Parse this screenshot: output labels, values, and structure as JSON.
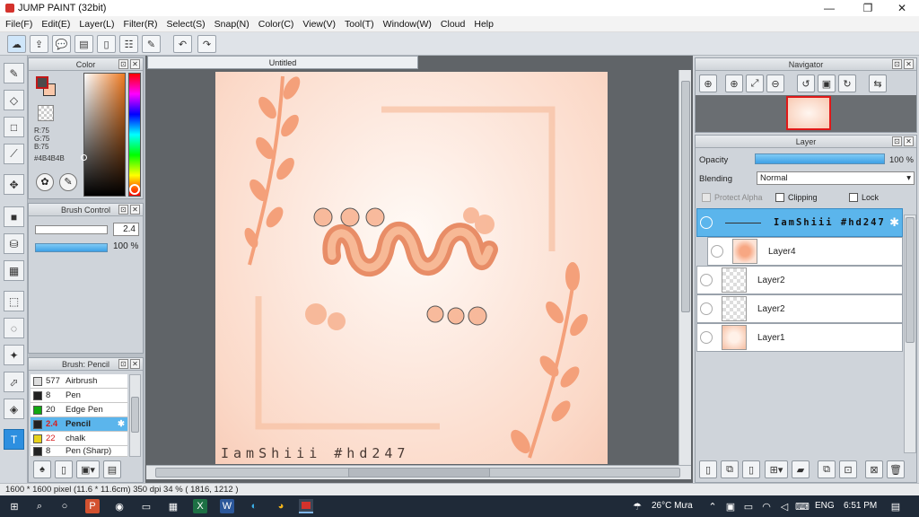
{
  "window": {
    "title": "JUMP PAINT (32bit)",
    "minimize": "—",
    "maximize": "❐",
    "close": "✕"
  },
  "menu": [
    "File(F)",
    "Edit(E)",
    "Layer(L)",
    "Filter(R)",
    "Select(S)",
    "Snap(N)",
    "Color(C)",
    "View(V)",
    "Tool(T)",
    "Window(W)",
    "Cloud",
    "Help"
  ],
  "color_panel": {
    "title": "Color",
    "r": "R:75",
    "g": "G:75",
    "b": "B:75",
    "hex": "#4B4B4B",
    "foreground": "#4b4b4b",
    "background": "#f9c7a9"
  },
  "brush_control": {
    "title": "Brush Control",
    "size": "2.4",
    "opacity": "100 %"
  },
  "brush_list": {
    "title": "Brush: Pencil",
    "items": [
      {
        "size": "577",
        "name": "Airbrush",
        "color": "#dddddd"
      },
      {
        "size": "8",
        "name": "Pen",
        "color": "#222222"
      },
      {
        "size": "20",
        "name": "Edge Pen",
        "color": "#11a811"
      },
      {
        "size": "2.4",
        "name": "Pencil",
        "color": "#222222"
      },
      {
        "size": "22",
        "name": "chalk",
        "color": "#e8d21a"
      },
      {
        "size": "8",
        "name": "Pen (Sharp)",
        "color": "#222222"
      }
    ]
  },
  "document": {
    "tab": "Untitled",
    "watermark": "IamShiii #hd247"
  },
  "navigator": {
    "title": "Navigator"
  },
  "layer_panel": {
    "title": "Layer",
    "opacity_label": "Opacity",
    "opacity_value": "100 %",
    "opacity_fraction": 1.0,
    "blending_label": "Blending",
    "blending_value": "Normal",
    "protect_alpha": "Protect Alpha",
    "clipping": "Clipping",
    "lock": "Lock",
    "folder_name": "IamShiii #hd247",
    "layers": [
      "Layer4",
      "Layer2",
      "Layer2",
      "Layer1"
    ]
  },
  "status": {
    "text": "1600 * 1600 pixel   (11.6 * 11.6cm)   350 dpi   34 %   ( 1816, 1212 )"
  },
  "taskbar": {
    "weather": "26°C  Mưa",
    "lang": "ENG",
    "time": "6:51 PM"
  },
  "accent": "#5bb5ec"
}
